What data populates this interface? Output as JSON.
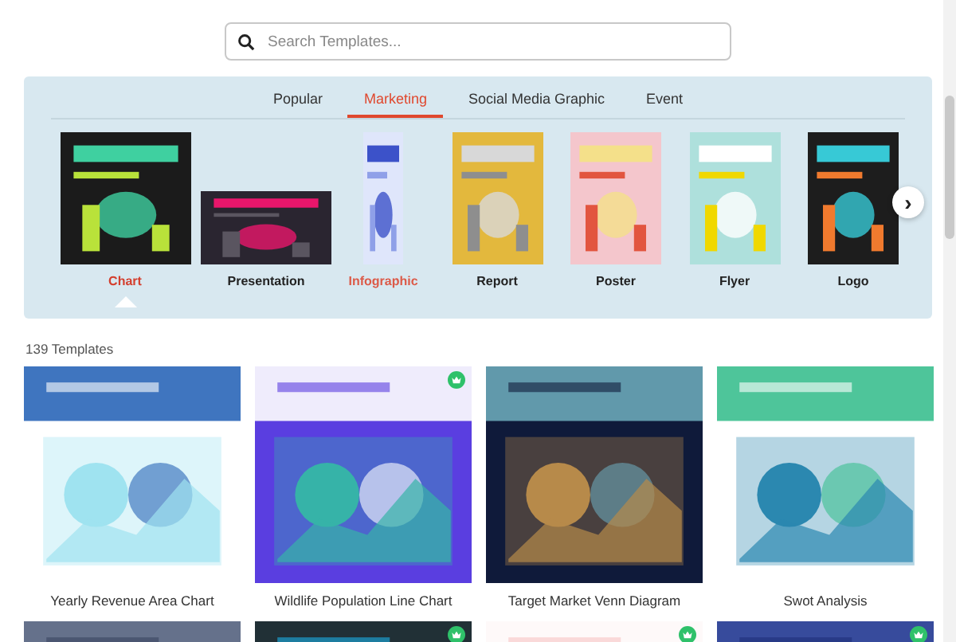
{
  "search": {
    "placeholder": "Search Templates..."
  },
  "tabs": [
    {
      "label": "Popular",
      "selected": false
    },
    {
      "label": "Marketing",
      "selected": true
    },
    {
      "label": "Social Media Graphic",
      "selected": false
    },
    {
      "label": "Event",
      "selected": false
    }
  ],
  "categories": [
    {
      "label": "Chart",
      "selected": true,
      "hovered": false
    },
    {
      "label": "Presentation",
      "selected": false,
      "hovered": false
    },
    {
      "label": "Infographic",
      "selected": false,
      "hovered": true
    },
    {
      "label": "Report",
      "selected": false,
      "hovered": false
    },
    {
      "label": "Poster",
      "selected": false,
      "hovered": false
    },
    {
      "label": "Flyer",
      "selected": false,
      "hovered": false
    },
    {
      "label": "Logo",
      "selected": false,
      "hovered": false
    }
  ],
  "next_button": {
    "icon": "›"
  },
  "count": "139 Templates",
  "templates": [
    {
      "title": "Yearly Revenue Area Chart",
      "premium": false
    },
    {
      "title": "Wildlife Population Line Chart",
      "premium": true
    },
    {
      "title": "Target Market Venn Diagram",
      "premium": false
    },
    {
      "title": "Swot Analysis",
      "premium": false
    },
    {
      "premium": false
    },
    {
      "premium": true
    },
    {
      "premium": true
    },
    {
      "premium": true
    }
  ]
}
